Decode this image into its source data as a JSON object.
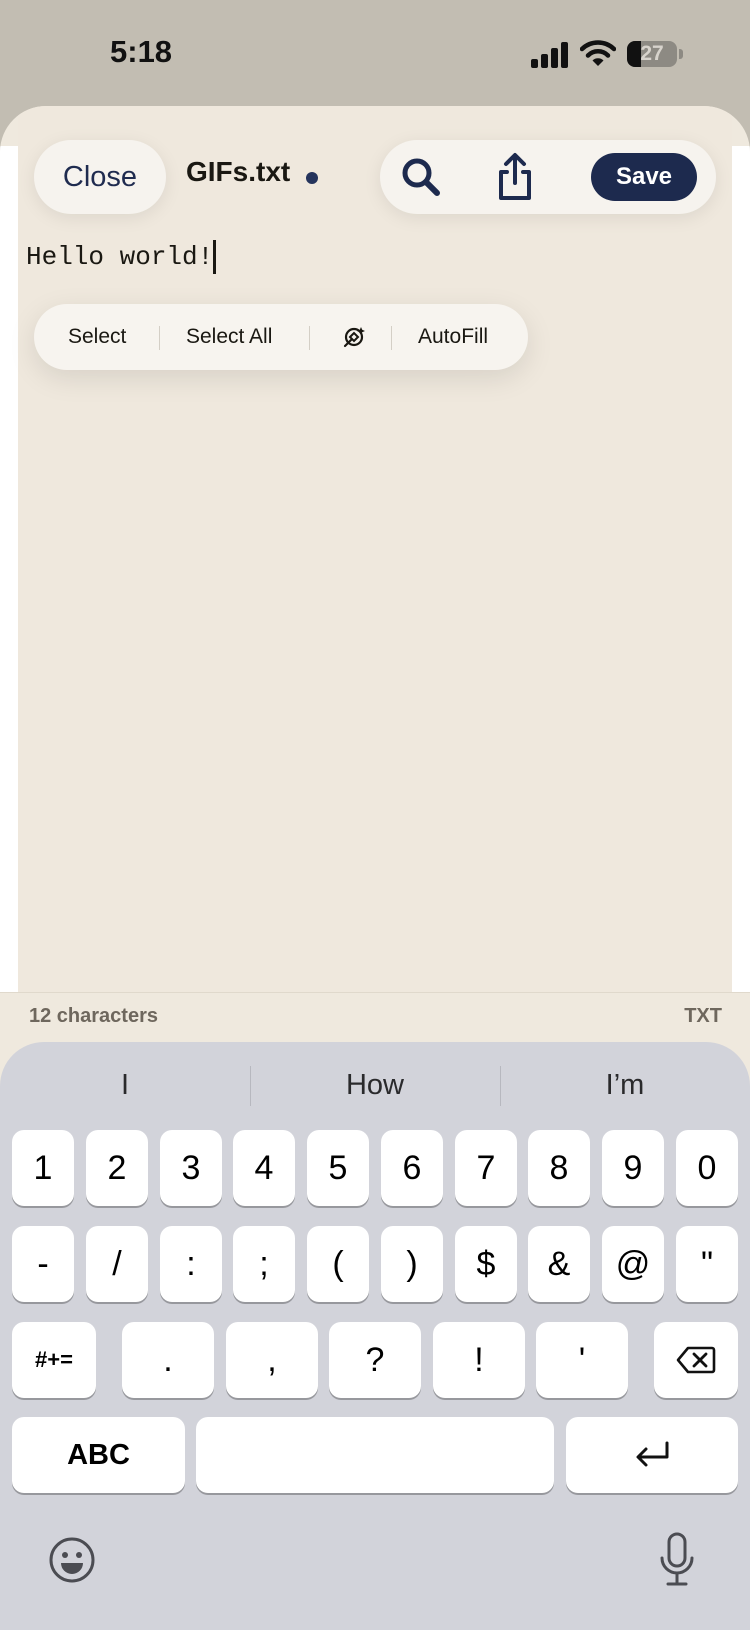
{
  "status_bar": {
    "time": "5:18",
    "battery_level": "27",
    "battery_fraction": 0.27,
    "icons": [
      "cellular-signal-icon",
      "wifi-icon",
      "battery-icon"
    ]
  },
  "header": {
    "close_label": "Close",
    "file_name": "GIFs.txt",
    "unsaved_indicator": true,
    "save_label": "Save",
    "icons": [
      "search-icon",
      "share-icon"
    ],
    "accent_color": "#1d2a4e"
  },
  "editor": {
    "content": "Hello world!",
    "background": "#efe8dd"
  },
  "edit_menu": {
    "items": [
      "Select",
      "Select All",
      "writing-tools-icon",
      "AutoFill"
    ],
    "select_label": "Select",
    "select_all_label": "Select All",
    "autofill_label": "AutoFill"
  },
  "footer": {
    "character_count": "12 characters",
    "file_type": "TXT"
  },
  "keyboard": {
    "suggestions": [
      "I",
      "How",
      "I’m"
    ],
    "row1": [
      "1",
      "2",
      "3",
      "4",
      "5",
      "6",
      "7",
      "8",
      "9",
      "0"
    ],
    "row2": [
      "-",
      "/",
      ":",
      ";",
      "(",
      ")",
      "$",
      "&",
      "@",
      "\""
    ],
    "row3": [
      "#+=",
      ".",
      ",",
      "?",
      "!",
      "'",
      "backspace-icon"
    ],
    "row4": [
      "ABC",
      "space",
      "return-icon"
    ],
    "symbols_label": "#+=",
    "abc_label": "ABC",
    "bottom_icons": [
      "emoji-icon",
      "microphone-icon"
    ]
  }
}
